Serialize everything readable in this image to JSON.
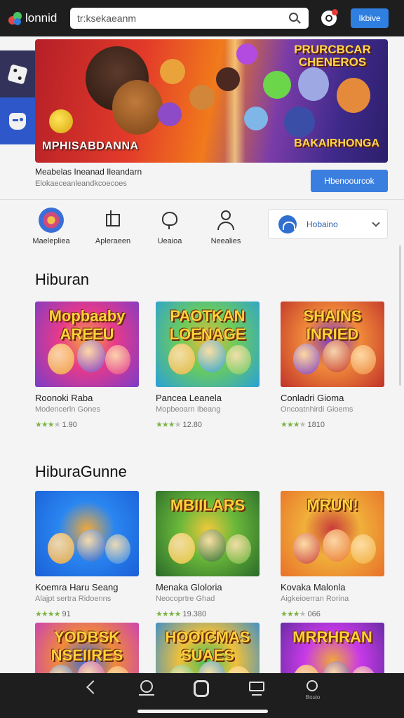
{
  "app": {
    "name": "lonnid"
  },
  "search": {
    "value": "tr:ksekaeanm"
  },
  "header": {
    "button_label": "Ikbive"
  },
  "banner": {
    "title": "MPHISABDANNA",
    "logo_text": "PRURCBCAR CHENEROS",
    "brand_text": "BAKAIRHONGA"
  },
  "info": {
    "title": "Meabelas Ineanad Ileandarn",
    "subtitle": "Elokaeceanleandkcoecoes",
    "button_label": "Hbenoourcok"
  },
  "categories": [
    {
      "label": "Maelepliea",
      "icon": "marketplace-icon"
    },
    {
      "label": "Apleraeen",
      "icon": "apps-icon"
    },
    {
      "label": "Ueaioa",
      "icon": "favorite-icon"
    },
    {
      "label": "Neealies",
      "icon": "user-icon"
    }
  ],
  "select": {
    "value": "Hobaino"
  },
  "sections": [
    {
      "title": "Hiburan",
      "items": [
        {
          "name": "Roonoki Raba",
          "sub": "Modencerln Gones",
          "rating": "1.90",
          "stars": 3,
          "thumb_title": "Mopbaaby AREEU",
          "colors": [
            "#7a3cc8",
            "#e83a8a",
            "#f3a83a"
          ]
        },
        {
          "name": "Pancea Leanela",
          "sub": "Mopbeoarn Ibeang",
          "rating": "12.80",
          "stars": 3,
          "thumb_title": "PAOTKAN LOENAGE",
          "colors": [
            "#2aa0d8",
            "#6ccc5a",
            "#f0b83a"
          ]
        },
        {
          "name": "Conladri Gioma",
          "sub": "Oncoatnhirdi Gioems",
          "rating": "1810",
          "stars": 3,
          "thumb_title": "SHAINS INRIED",
          "colors": [
            "#c0322a",
            "#f08a3a",
            "#7a3ac8"
          ]
        }
      ]
    },
    {
      "title": "HiburaGunne",
      "items": [
        {
          "name": "Koemra Haru Seang",
          "sub": "Alajpt sertra Ridoenns",
          "rating": "91",
          "stars": 4,
          "thumb_title": "",
          "colors": [
            "#1a5fd8",
            "#2a86f0",
            "#f0a83a"
          ]
        },
        {
          "name": "Menaka Gloloria",
          "sub": "Neocoprtre Ghad",
          "rating": "19.380",
          "stars": 4,
          "thumb_title": "MBIILARS",
          "colors": [
            "#2a6a2a",
            "#6ab83a",
            "#f0c83a"
          ]
        },
        {
          "name": "Kovaka Malonla",
          "sub": "Aigkeioerran Rorina",
          "rating": "066",
          "stars": 3,
          "thumb_title": "MRUN!",
          "colors": [
            "#e8702a",
            "#f0b03a",
            "#c83a3a"
          ]
        }
      ]
    },
    {
      "title": "",
      "items": [
        {
          "thumb_title": "YODBSK NSEIIRES",
          "colors": [
            "#c83ac0",
            "#f08a3a",
            "#3a6ad8"
          ]
        },
        {
          "thumb_title": "HOOICMAS SUAES",
          "colors": [
            "#2a8ad8",
            "#f0c03a",
            "#3ac05a"
          ]
        },
        {
          "thumb_title": "MRRHRAN",
          "colors": [
            "#5a2a9a",
            "#c83ae8",
            "#f0a83a"
          ]
        }
      ]
    }
  ],
  "nav": {
    "profile_label": "Bouio"
  }
}
